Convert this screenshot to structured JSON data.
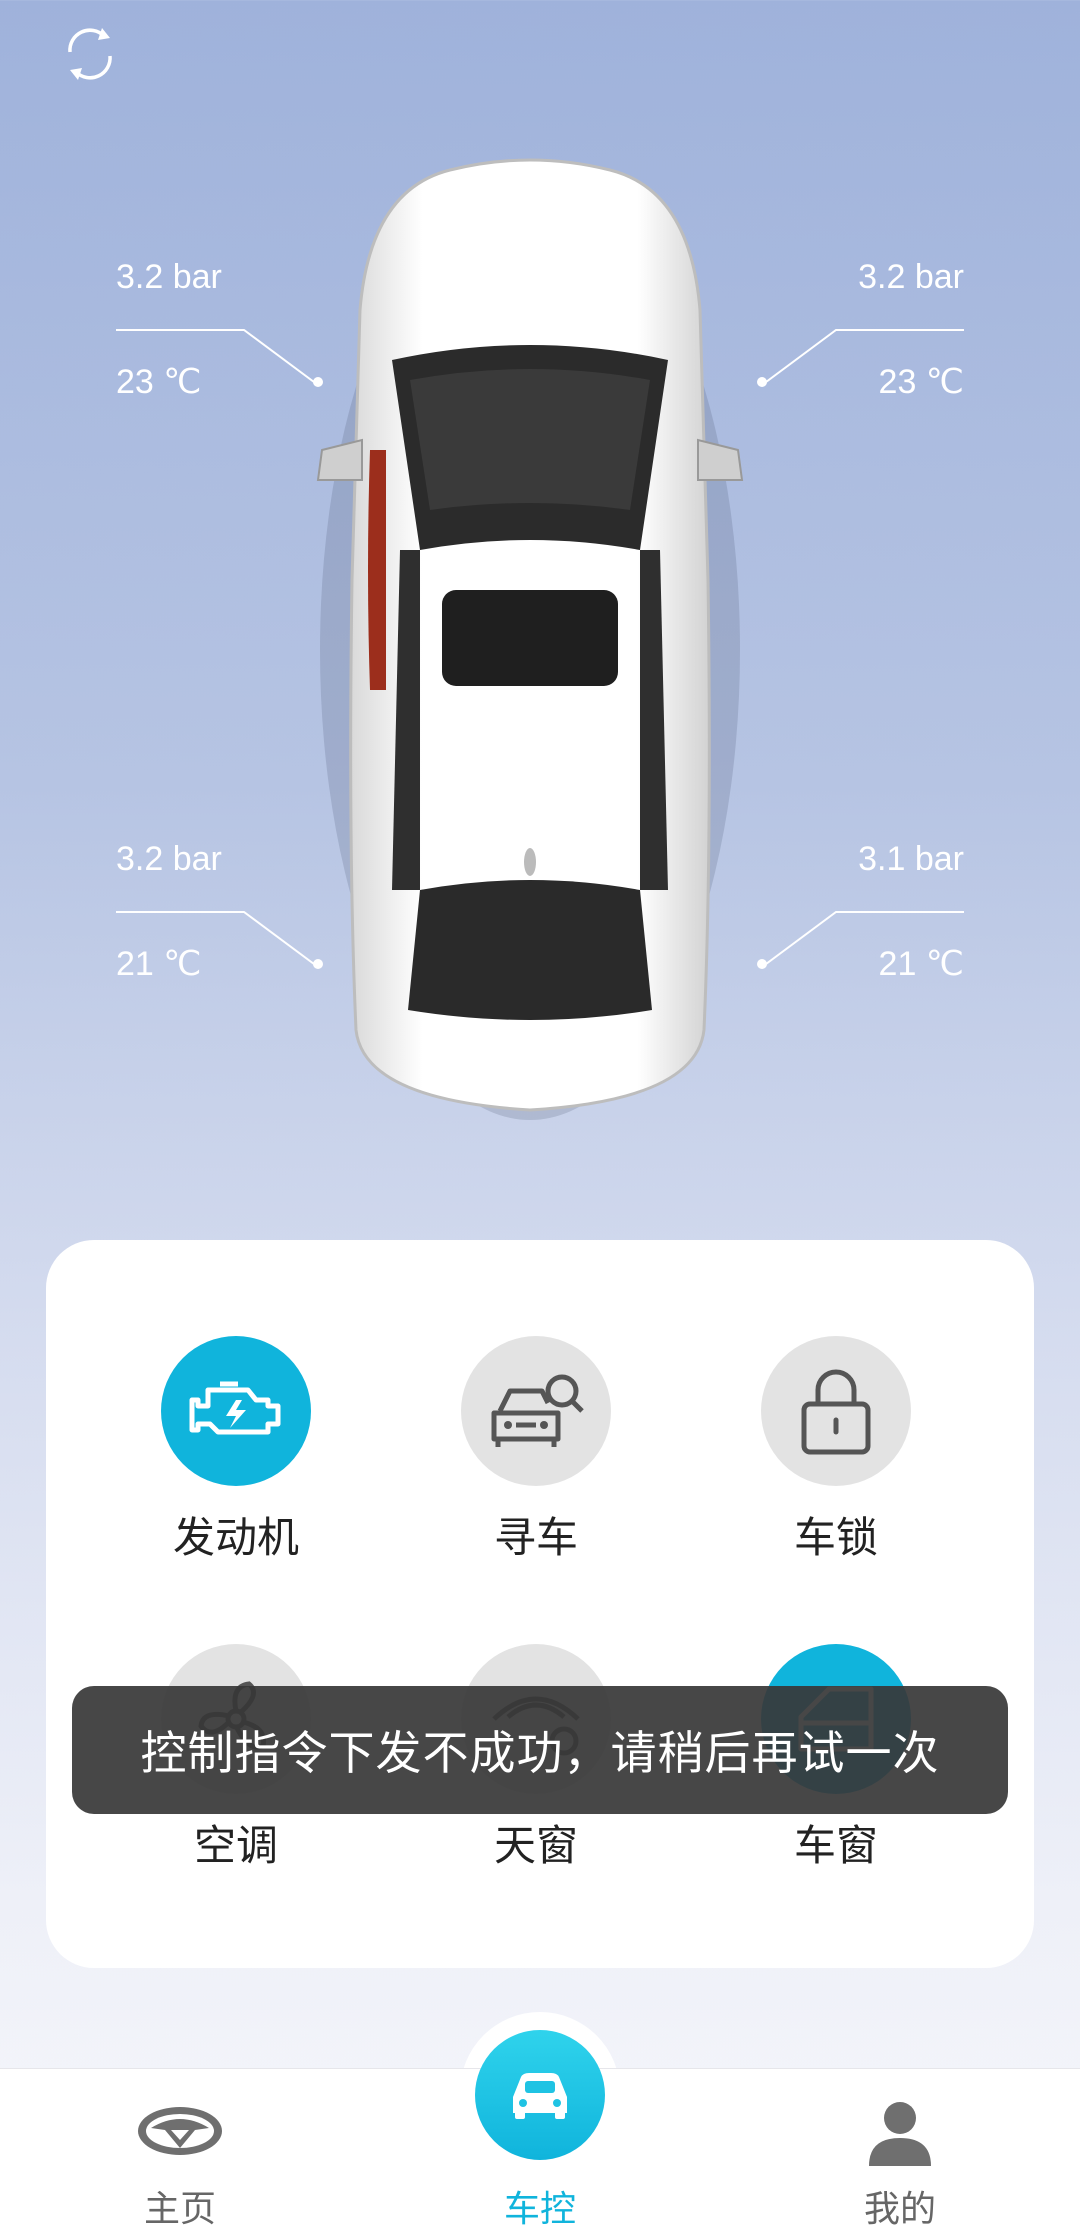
{
  "tires": {
    "front_left": {
      "pressure": "3.2 bar",
      "temp": "23 ℃"
    },
    "front_right": {
      "pressure": "3.2 bar",
      "temp": "23 ℃"
    },
    "rear_left": {
      "pressure": "3.2 bar",
      "temp": "21 ℃"
    },
    "rear_right": {
      "pressure": "3.1 bar",
      "temp": "21 ℃"
    }
  },
  "controls": [
    {
      "label": "发动机",
      "icon": "engine-icon",
      "active": true
    },
    {
      "label": "寻车",
      "icon": "find-car-icon",
      "active": false
    },
    {
      "label": "车锁",
      "icon": "lock-icon",
      "active": false
    },
    {
      "label": "空调",
      "icon": "fan-icon",
      "active": false
    },
    {
      "label": "天窗",
      "icon": "sunroof-icon",
      "active": false
    },
    {
      "label": "车窗",
      "icon": "window-icon",
      "active": true
    }
  ],
  "toast": {
    "message": "控制指令下发不成功，请稍后再试一次"
  },
  "tabbar": {
    "items": [
      {
        "label": "主页",
        "icon": "brand-logo-icon",
        "active": false
      },
      {
        "label": "车控",
        "icon": "car-icon",
        "active": true
      },
      {
        "label": "我的",
        "icon": "person-icon",
        "active": false
      }
    ]
  },
  "colors": {
    "accent": "#10b4dc",
    "inactive_circle": "#e3e3e3",
    "toast_bg": "#373737"
  }
}
